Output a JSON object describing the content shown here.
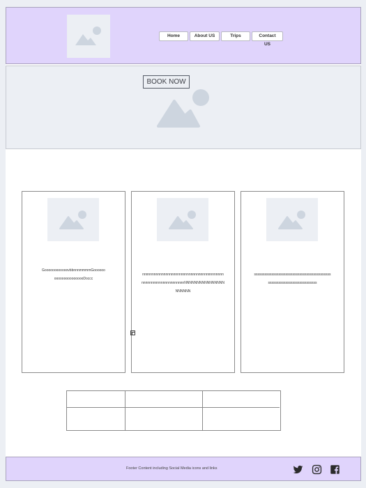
{
  "header": {
    "logo_icon": "image-placeholder-icon",
    "nav": [
      {
        "label": "Home"
      },
      {
        "label": "About US"
      },
      {
        "label": "Trips"
      },
      {
        "label": "Contact US"
      }
    ]
  },
  "hero": {
    "button_label": "BOOK NOW",
    "image_icon": "image-placeholder-icon"
  },
  "cards": [
    {
      "text": "GoooooooooooovbbnnnmmmmGoooooooooooooooooooooDoccc"
    },
    {
      "text": "nnnnnnnnnnnnnnnnnnnnnnnnnnnnnnnnnnnnnnnnnnnnnnnnnnnnnnnnnnnnnnnnNNNNNNNNNNNNNNNNNNNNNN"
    },
    {
      "text": "ssssssssssssssssssssssssssssssssssssssssssssssssssssssssssssssssssssssss"
    }
  ],
  "footer": {
    "text": "Footer Content including Social Media icons and links",
    "social": [
      "twitter-icon",
      "instagram-icon",
      "facebook-icon"
    ]
  },
  "colors": {
    "header_bg": "#e0d4fc",
    "placeholder_bg": "#eceff4",
    "placeholder_shape": "#cdd5df"
  }
}
